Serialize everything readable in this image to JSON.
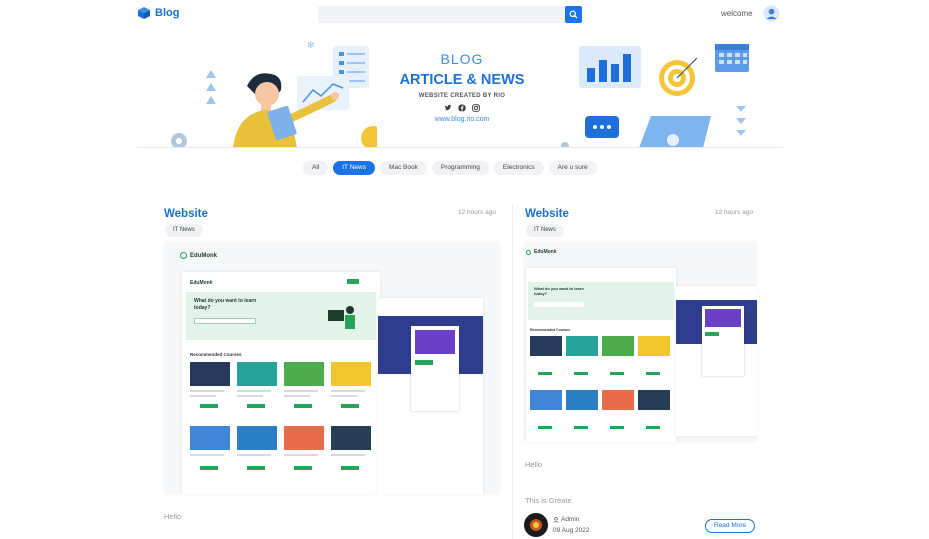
{
  "header": {
    "brand": "Blog",
    "search_placeholder": "",
    "welcome": "welcome",
    "icons": [
      "cube-icon",
      "search-icon",
      "user-icon"
    ]
  },
  "hero": {
    "subtitle": "BLOG",
    "title": "ARTICLE & NEWS",
    "credit": "WEBSITE CREATED BY RIO",
    "url": "www.blog.rio.com",
    "social_icons": [
      "twitter-icon",
      "facebook-icon",
      "instagram-icon"
    ]
  },
  "categories": {
    "items": [
      "All",
      "IT News",
      "Mac Book",
      "Programming",
      "Electronics",
      "Are u sure"
    ],
    "active": "IT News"
  },
  "posts": [
    {
      "title": "Website",
      "time": "12 hours ago",
      "tag": "IT News",
      "thumb": {
        "brand": "EduMonk",
        "headline": "What do you want to learn today?",
        "section": "Recommended Courses"
      },
      "excerpt": "Hello"
    },
    {
      "title": "Website",
      "time": "12 hours ago",
      "tag": "IT News",
      "thumb": {
        "brand": "EduMonk",
        "headline": "What do you want to learn today?",
        "section": "Recommended Courses"
      },
      "excerpt": "Hello",
      "description": "This is Greate.",
      "author": "Admin",
      "date": "09 Aug 2022",
      "read_more": "Read More"
    }
  ],
  "colors": {
    "accent": "#1a73e8",
    "brand": "#1a6fd6",
    "muted": "#999999",
    "chip_bg": "#f0f2f5",
    "edu_green": "#27a359"
  }
}
